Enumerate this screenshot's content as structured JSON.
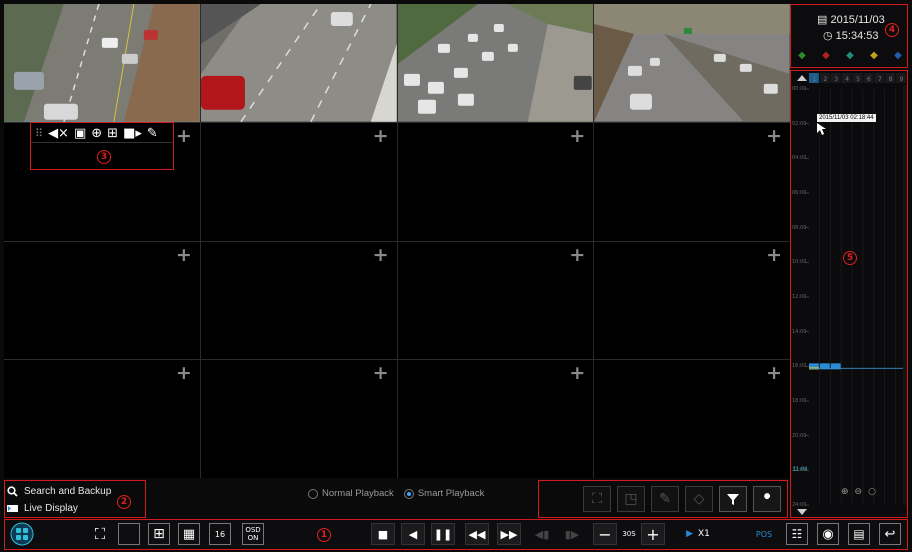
{
  "channel_toolbar": {
    "icons": [
      "drag-handle-icon",
      "audio-icon",
      "snapshot-icon",
      "zoom-icon",
      "tag-icon",
      "record-icon",
      "edit-icon"
    ],
    "annotation": "3"
  },
  "left_panel": {
    "search_label": "Search and Backup",
    "live_label": "Live Display",
    "annotation": "2"
  },
  "playback_mode": {
    "normal_label": "Normal Playback",
    "smart_label": "Smart Playback",
    "selected": "smart"
  },
  "datetime": {
    "date": "2015/11/03",
    "time": "15:34:53",
    "annotation": "4"
  },
  "timeline": {
    "tooltip": "2015/11/03 02:18:44",
    "annotation": "5",
    "hours": [
      "00:00",
      "02:00",
      "04:00",
      "06:00",
      "08:00",
      "10:00",
      "12:00",
      "14:00",
      "16:00",
      "18:00",
      "20:00",
      "22:00",
      "24:00"
    ],
    "channels": [
      "1",
      "2",
      "3",
      "4",
      "5",
      "6",
      "7",
      "8",
      "9"
    ],
    "marker_label": "11:04"
  },
  "bottom_bar": {
    "annotation": "1",
    "interval": "30S",
    "speed": "X1",
    "pos_label": "POS",
    "osd_line1": "OSD",
    "osd_line2": "ON",
    "split_label": "16"
  },
  "colors": {
    "accent": "#2fc0d8",
    "annotation": "#d21c1c",
    "record_marker": "#2a8bd6"
  }
}
